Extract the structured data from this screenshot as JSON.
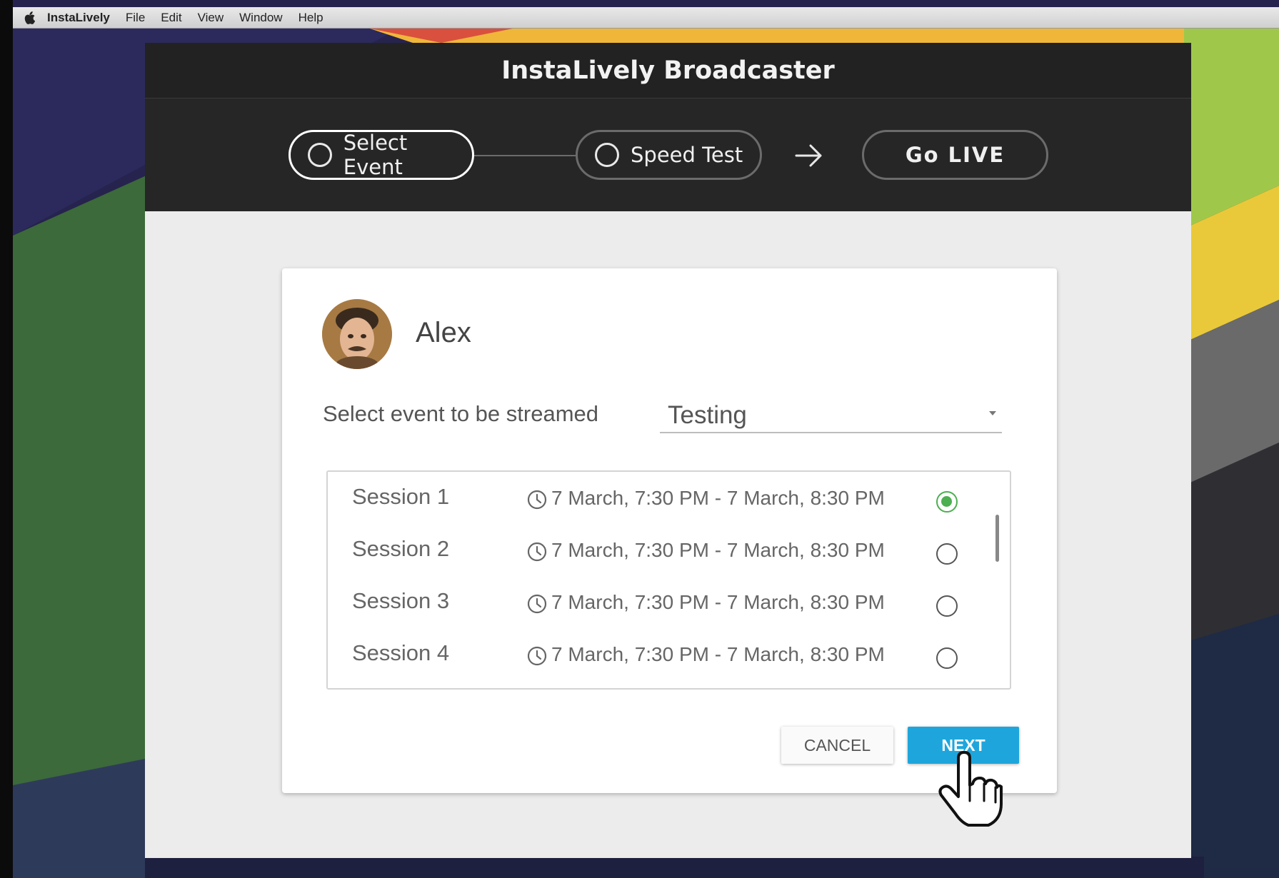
{
  "menubar": {
    "app_name": "InstaLively",
    "items": [
      "File",
      "Edit",
      "View",
      "Window",
      "Help"
    ]
  },
  "window": {
    "title": "InstaLively Broadcaster"
  },
  "stepper": {
    "steps": [
      {
        "label": "Select Event",
        "active": true
      },
      {
        "label": "Speed Test",
        "active": false
      },
      {
        "label": "Go LIVE",
        "active": false
      }
    ]
  },
  "user": {
    "name": "Alex"
  },
  "event": {
    "label": "Select event to be streamed",
    "selected": "Testing"
  },
  "sessions": [
    {
      "name": "Session 1",
      "time": "7 March, 7:30 PM - 7 March, 8:30 PM",
      "selected": true
    },
    {
      "name": "Session 2",
      "time": "7 March, 7:30 PM - 7 March, 8:30 PM",
      "selected": false
    },
    {
      "name": "Session 3",
      "time": "7 March, 7:30 PM - 7 March, 8:30 PM",
      "selected": false
    },
    {
      "name": "Session 4",
      "time": "7 March, 7:30 PM - 7 March, 8:30 PM",
      "selected": false
    }
  ],
  "buttons": {
    "cancel": "CANCEL",
    "next": "NEXT"
  },
  "colors": {
    "accent": "#1ea6dc",
    "selected_radio": "#4caf50",
    "titlebar": "#222222"
  }
}
